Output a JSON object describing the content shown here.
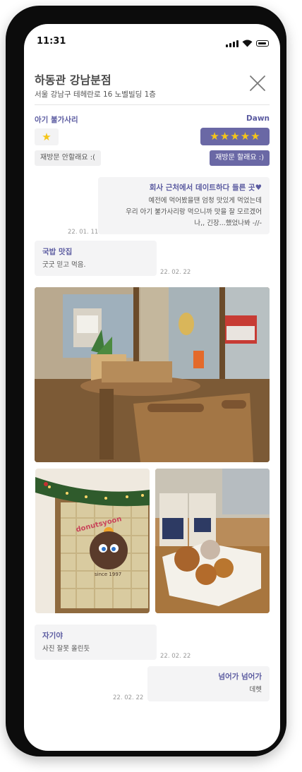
{
  "status": {
    "time": "11:31"
  },
  "header": {
    "title": "하동관 강남분점",
    "address": "서울 강남구 테헤란로 16 노벨빌딩 1층"
  },
  "rating": {
    "left_user": "아기 불가사리",
    "right_user": "Dawn",
    "left_stars": 1,
    "right_stars": 5,
    "left_tag": "재방문 안할래요 :(",
    "right_tag": "재방문 할래요 :)"
  },
  "messages": [
    {
      "title": "회사 근처에서 데이트하다 들른 곳♥",
      "lines": [
        "예전에 먹어봤을땐 엄청 맛있게 먹었는데",
        "우리 아기 불가사리랑 먹으니까 맛을 잘 모르겠어",
        "나,, 긴장...했었나봐 -//-"
      ],
      "date": "22. 01. 11"
    },
    {
      "title": "국밥 맛집",
      "lines": [
        "굿굿 믿고 먹음."
      ],
      "date": "22. 02. 22"
    },
    {
      "title": "자기야",
      "lines": [
        "사진 잘못 올린듯"
      ],
      "date": "22. 02. 22"
    },
    {
      "title": "넘어가 넘어가",
      "lines": [
        "데헷"
      ],
      "date": "22. 02. 22"
    }
  ],
  "photos": {
    "mural_sign_text": "donutsyoon",
    "mural_since_text": "since 1997"
  },
  "colors": {
    "accent": "#6a68a5",
    "accent_text": "#5a5aa0",
    "star": "#f5c518",
    "bubble": "#f4f4f5"
  },
  "icons": [
    "signal-icon",
    "wifi-icon",
    "battery-icon",
    "close-icon",
    "star-icon"
  ]
}
